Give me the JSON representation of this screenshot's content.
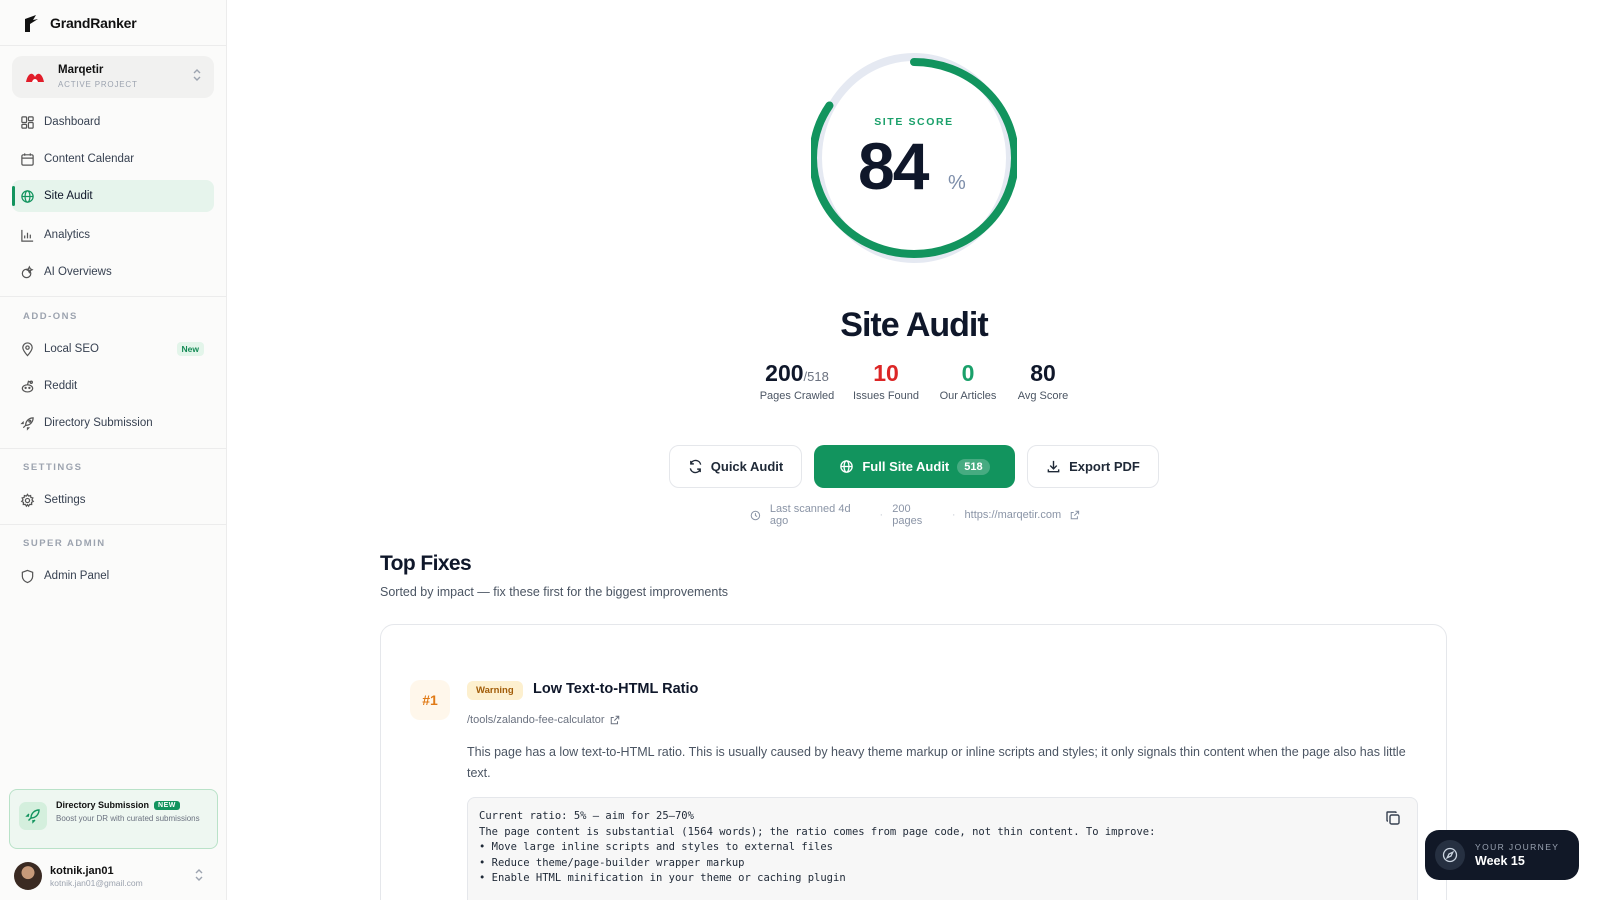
{
  "app": {
    "brand": "GrandRanker"
  },
  "project": {
    "name": "Marqetir",
    "subtitle": "ACTIVE PROJECT"
  },
  "nav": {
    "main": [
      {
        "label": "Dashboard",
        "icon": "layout-grid-icon"
      },
      {
        "label": "Content Calendar",
        "icon": "calendar-icon"
      },
      {
        "label": "Site Audit",
        "icon": "globe-icon",
        "active": true
      },
      {
        "label": "Analytics",
        "icon": "bar-chart-icon"
      },
      {
        "label": "AI Overviews",
        "icon": "ai-overviews-icon"
      }
    ],
    "addons_label": "ADD-ONS",
    "addons": [
      {
        "label": "Local SEO",
        "icon": "map-pin-icon",
        "badge": "New"
      },
      {
        "label": "Reddit",
        "icon": "reddit-icon"
      },
      {
        "label": "Directory Submission",
        "icon": "rocket-icon"
      }
    ],
    "settings_label": "SETTINGS",
    "settings": [
      {
        "label": "Settings",
        "icon": "gear-icon"
      }
    ],
    "superadmin_label": "SUPER ADMIN",
    "superadmin": [
      {
        "label": "Admin Panel",
        "icon": "shield-icon"
      }
    ]
  },
  "promo": {
    "title": "Directory Submission",
    "badge": "NEW",
    "description": "Boost your DR with curated submissions"
  },
  "user": {
    "name": "kotnik.jan01",
    "email": "kotnik.jan01@gmail.com"
  },
  "score": {
    "label": "SITE SCORE",
    "value": "84",
    "unit": "%",
    "progress": 0.84
  },
  "page": {
    "title": "Site Audit"
  },
  "stats": [
    {
      "value": "200",
      "suffix": "/518",
      "label": "Pages Crawled",
      "color": "#0f172a"
    },
    {
      "value": "10",
      "suffix": "",
      "label": "Issues Found",
      "color": "#dc2626"
    },
    {
      "value": "0",
      "suffix": "",
      "label": "Our Articles",
      "color": "#1aa06a"
    },
    {
      "value": "80",
      "suffix": "",
      "label": "Avg Score",
      "color": "#0f172a"
    }
  ],
  "actions": {
    "quick": "Quick Audit",
    "full": "Full Site Audit",
    "full_count": "518",
    "export": "Export PDF"
  },
  "meta": {
    "scanned": "Last scanned 4d ago",
    "pages": "200 pages",
    "url": "https://marqetir.com"
  },
  "top_fixes": {
    "title": "Top Fixes",
    "subtitle": "Sorted by impact — fix these first for the biggest improvements",
    "items": [
      {
        "rank": "#1",
        "severity": "Warning",
        "title": "Low Text-to-HTML Ratio",
        "url": "/tools/zalando-fee-calculator",
        "description": "This page has a low text-to-HTML ratio. This is usually caused by heavy theme markup or inline scripts and styles; it only signals thin content when the page also has little text.",
        "code_lines": [
          "Current ratio: 5% — aim for 25–70%",
          "",
          "The page content is substantial (1564 words); the ratio comes from page code, not thin content. To improve:",
          "• Move large inline scripts and styles to external files",
          "• Reduce theme/page-builder wrapper markup",
          "• Enable HTML minification in your theme or caching plugin"
        ]
      }
    ]
  },
  "journey": {
    "label": "YOUR JOURNEY",
    "week": "Week 15"
  },
  "colors": {
    "accent": "#12945e",
    "danger": "#dc2626",
    "warning": "#e07a16"
  }
}
